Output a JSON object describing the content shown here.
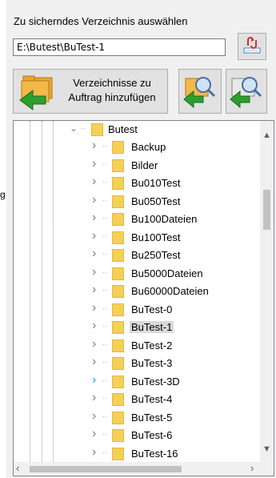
{
  "header": {
    "label": "Zu sicherndes Verzeichnis auswählen"
  },
  "path_input": {
    "value": "E:\\Butest\\BuTest-1"
  },
  "edge_text": "g",
  "buttons": {
    "drive_icon": "drive-sync-icon",
    "add_label_line1": "Verzeichnisse zu",
    "add_label_line2": "Auftrag hinzufügen",
    "search_icon_1": "search-folder-icon",
    "search_icon_2": "search-folder-icon"
  },
  "tree": {
    "root": {
      "label": "Butest",
      "expanded": true
    },
    "items": [
      {
        "label": "Backup",
        "selected": false,
        "chevron_active": false
      },
      {
        "label": "Bilder",
        "selected": false,
        "chevron_active": false
      },
      {
        "label": "Bu010Test",
        "selected": false,
        "chevron_active": false
      },
      {
        "label": "Bu050Test",
        "selected": false,
        "chevron_active": false
      },
      {
        "label": "Bu100Dateien",
        "selected": false,
        "chevron_active": false
      },
      {
        "label": "Bu100Test",
        "selected": false,
        "chevron_active": false
      },
      {
        "label": "Bu250Test",
        "selected": false,
        "chevron_active": false
      },
      {
        "label": "Bu5000Dateien",
        "selected": false,
        "chevron_active": false
      },
      {
        "label": "Bu60000Dateien",
        "selected": false,
        "chevron_active": false
      },
      {
        "label": "BuTest-0",
        "selected": false,
        "chevron_active": false
      },
      {
        "label": "BuTest-1",
        "selected": true,
        "chevron_active": false
      },
      {
        "label": "BuTest-2",
        "selected": false,
        "chevron_active": false
      },
      {
        "label": "BuTest-3",
        "selected": false,
        "chevron_active": false
      },
      {
        "label": "BuTest-3D",
        "selected": false,
        "chevron_active": true
      },
      {
        "label": "BuTest-4",
        "selected": false,
        "chevron_active": false
      },
      {
        "label": "BuTest-5",
        "selected": false,
        "chevron_active": false
      },
      {
        "label": "BuTest-6",
        "selected": false,
        "chevron_active": false
      },
      {
        "label": "BuTest-16",
        "selected": false,
        "chevron_active": false
      }
    ]
  },
  "colors": {
    "folder": "#f5d057",
    "selection": "#d9d9d9",
    "chevron_active": "#1fa7e6",
    "arrow_green": "#2e9e2e"
  }
}
